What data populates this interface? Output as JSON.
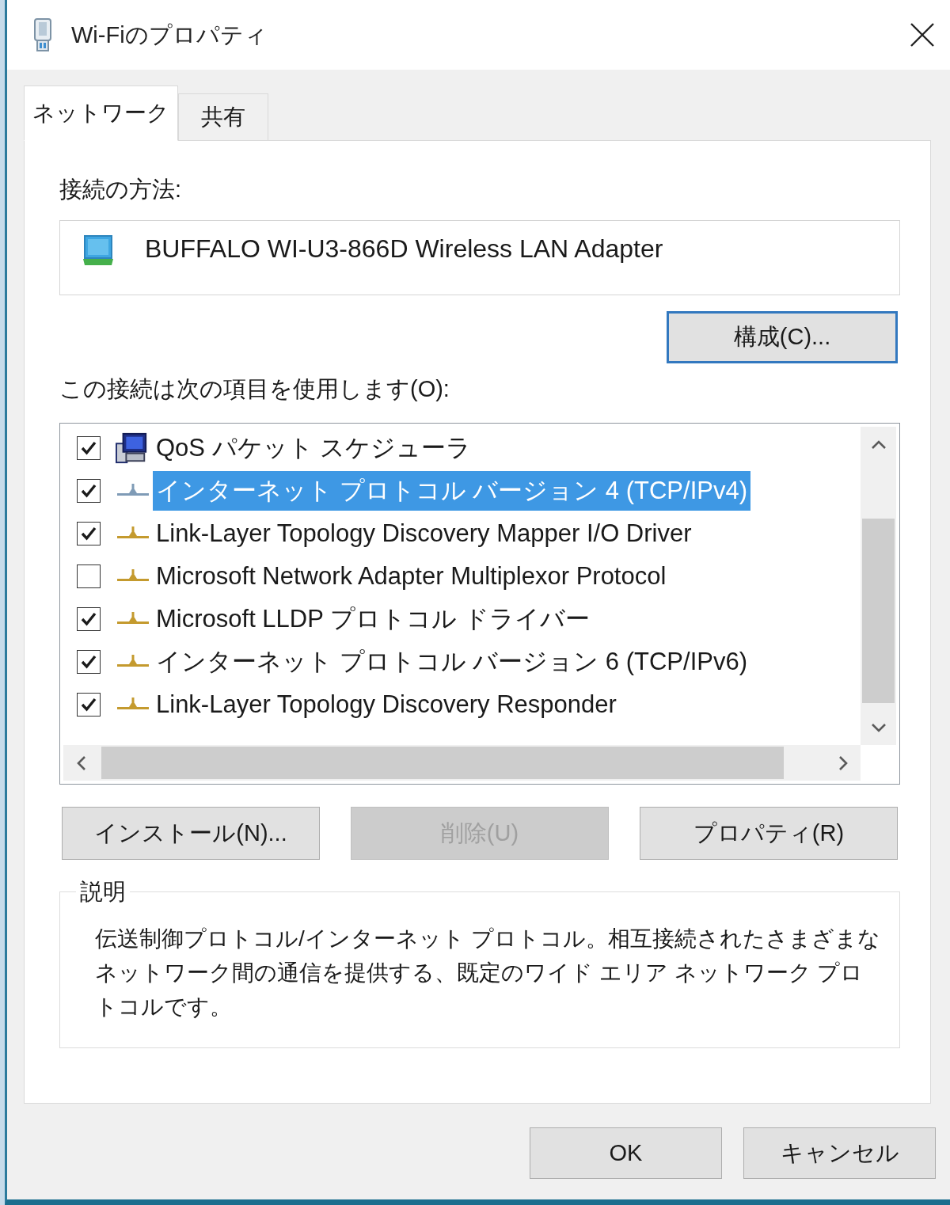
{
  "window": {
    "title": "Wi-Fiのプロパティ"
  },
  "tabs": [
    {
      "label": "ネットワーク",
      "selected": true
    },
    {
      "label": "共有",
      "selected": false
    }
  ],
  "connect_using": {
    "label": "接続の方法:",
    "adapter": "BUFFALO WI-U3-866D Wireless LAN Adapter",
    "configure_button": {
      "label": "構成(C)...",
      "focused": true
    }
  },
  "components": {
    "label": "この接続は次の項目を使用します(O):",
    "items": [
      {
        "label": "QoS パケット スケジューラ",
        "kind": "service",
        "checked": true,
        "selected": false
      },
      {
        "label": "インターネット プロトコル バージョン 4 (TCP/IPv4)",
        "kind": "protocol",
        "checked": true,
        "selected": true
      },
      {
        "label": "Link-Layer Topology Discovery Mapper I/O Driver",
        "kind": "protocol",
        "checked": true,
        "selected": false
      },
      {
        "label": "Microsoft Network Adapter Multiplexor Protocol",
        "kind": "protocol",
        "checked": false,
        "selected": false
      },
      {
        "label": "Microsoft LLDP プロトコル ドライバー",
        "kind": "protocol",
        "checked": true,
        "selected": false
      },
      {
        "label": "インターネット プロトコル バージョン 6 (TCP/IPv6)",
        "kind": "protocol",
        "checked": true,
        "selected": false
      },
      {
        "label": "Link-Layer Topology Discovery Responder",
        "kind": "protocol",
        "checked": true,
        "selected": false
      }
    ]
  },
  "component_buttons": [
    {
      "label": "インストール(N)...",
      "disabled": false
    },
    {
      "label": "削除(U)",
      "disabled": true
    },
    {
      "label": "プロパティ(R)",
      "disabled": false
    }
  ],
  "description": {
    "title": "説明",
    "text": "伝送制御プロトコル/インターネット プロトコル。相互接続されたさまざまなネットワーク間の通信を提供する、既定のワイド エリア ネットワーク プロトコルです。"
  },
  "dialog_buttons": [
    "OK",
    "キャンセル"
  ]
}
